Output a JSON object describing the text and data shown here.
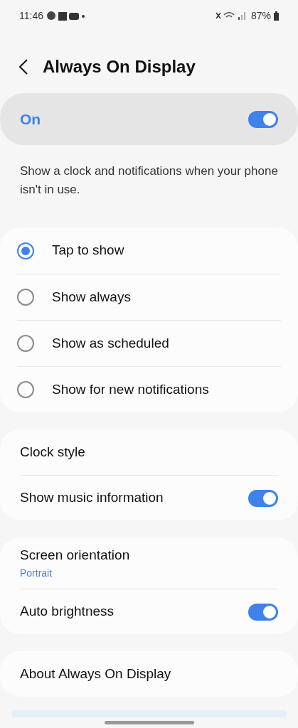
{
  "status_bar": {
    "time": "11:46",
    "battery": "87%"
  },
  "title": "Always On Display",
  "master": {
    "label": "On",
    "on": true
  },
  "description": "Show a clock and notifications when your phone isn't in use.",
  "modes": [
    {
      "label": "Tap to show",
      "selected": true
    },
    {
      "label": "Show always",
      "selected": false
    },
    {
      "label": "Show as scheduled",
      "selected": false
    },
    {
      "label": "Show for new notifications",
      "selected": false
    }
  ],
  "groups": [
    [
      {
        "kind": "link",
        "label": "Clock style"
      },
      {
        "kind": "switch",
        "label": "Show music information",
        "on": true
      }
    ],
    [
      {
        "kind": "link",
        "label": "Screen orientation",
        "value": "Portrait"
      },
      {
        "kind": "switch",
        "label": "Auto brightness",
        "on": true
      }
    ],
    [
      {
        "kind": "link",
        "label": "About Always On Display"
      }
    ]
  ]
}
